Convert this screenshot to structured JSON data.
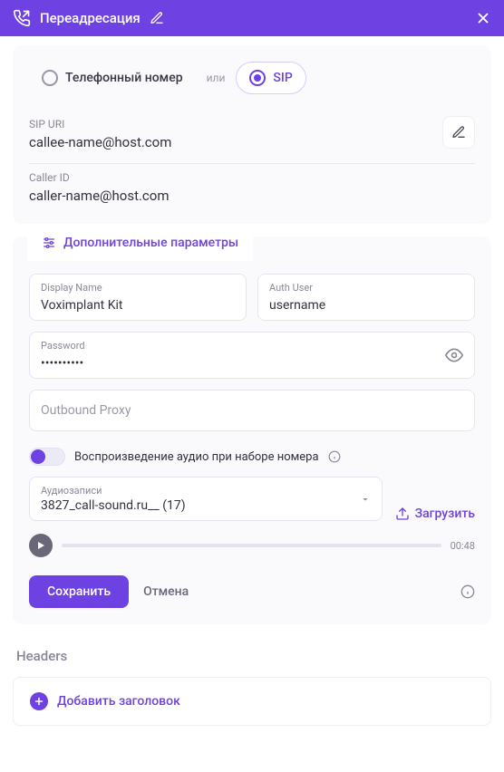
{
  "header": {
    "title": "Переадресация"
  },
  "mode": {
    "phone_label": "Телефонный номер",
    "or_label": "или",
    "sip_label": "SIP"
  },
  "sip": {
    "uri_label": "SIP URI",
    "uri_value": "callee-name@host.com",
    "caller_label": "Caller ID",
    "caller_value": "caller-name@host.com"
  },
  "advanced": {
    "tab_title": "Дополнительные параметры",
    "display_name_label": "Display Name",
    "display_name_value": "Voximplant Kit",
    "auth_user_label": "Auth User",
    "auth_user_value": "username",
    "password_label": "Password",
    "password_value": "••••••••••",
    "outbound_proxy_placeholder": "Outbound Proxy",
    "playback_label": "Воспроизведение аудио при наборе номера",
    "audio_label": "Аудиозаписи",
    "audio_selected": "3827_call-sound.ru__ (17)",
    "upload_label": "Загрузить",
    "duration": "00:48"
  },
  "actions": {
    "save": "Сохранить",
    "cancel": "Отмена"
  },
  "headers_section": {
    "title": "Headers",
    "add_label": "Добавить заголовок"
  }
}
